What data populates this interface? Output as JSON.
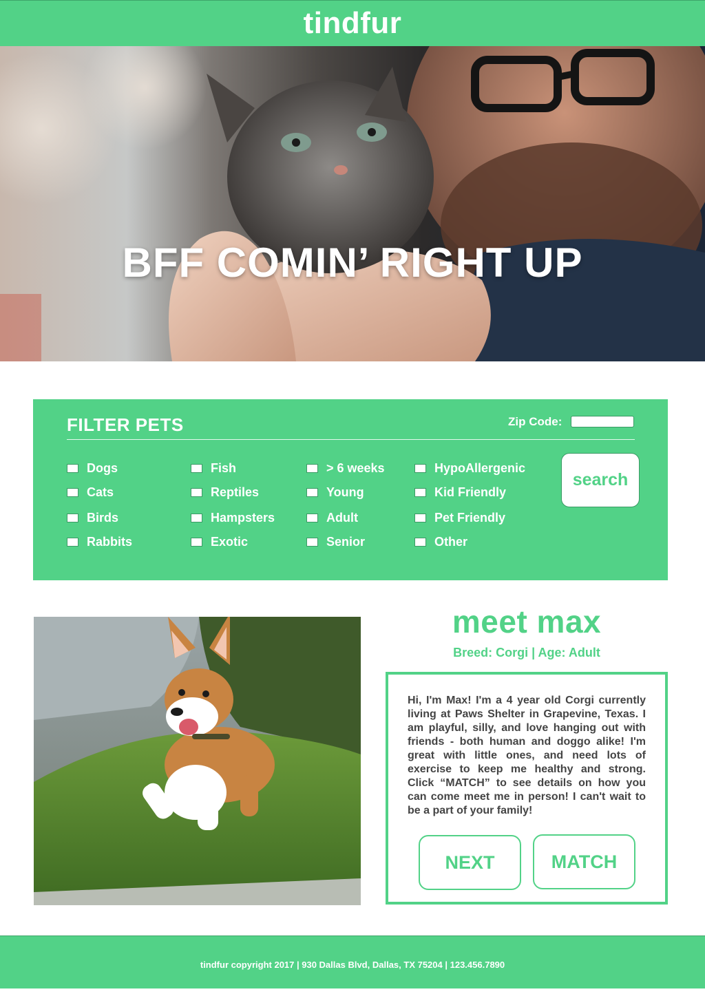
{
  "header": {
    "logo": "tindfur"
  },
  "hero": {
    "title": "BFF COMIN’ RIGHT UP"
  },
  "filter": {
    "title": "FILTER PETS",
    "zip_label": "Zip Code:",
    "zip_value": "",
    "search_label": "search",
    "columns": [
      [
        "Dogs",
        "Cats",
        "Birds",
        "Rabbits"
      ],
      [
        "Fish",
        "Reptiles",
        "Hampsters",
        "Exotic"
      ],
      [
        "> 6 weeks",
        "Young",
        "Adult",
        "Senior"
      ],
      [
        "HypoAllergenic",
        "Kid Friendly",
        "Pet Friendly",
        "Other"
      ]
    ]
  },
  "profile": {
    "name": "meet max",
    "meta": "Breed: Corgi  | Age: Adult",
    "bio": "Hi, I'm Max! I'm a 4 year old Corgi currently living at Paws Shelter in Grapevine, Texas. I am playful, silly, and love hanging out with friends - both human and doggo alike! I'm great with little ones, and need lots of exercise to keep me healthy and strong. Click “MATCH” to see details on how you can come meet me in person! I can't wait to be a part of your family!",
    "next_label": "NEXT",
    "match_label": "MATCH"
  },
  "footer": {
    "text": "tindfur copyright 2017 | 930 Dallas Blvd, Dallas, TX 75204 | 123.456.7890"
  },
  "colors": {
    "brand_green": "#52d287",
    "text_dark": "#444444"
  }
}
